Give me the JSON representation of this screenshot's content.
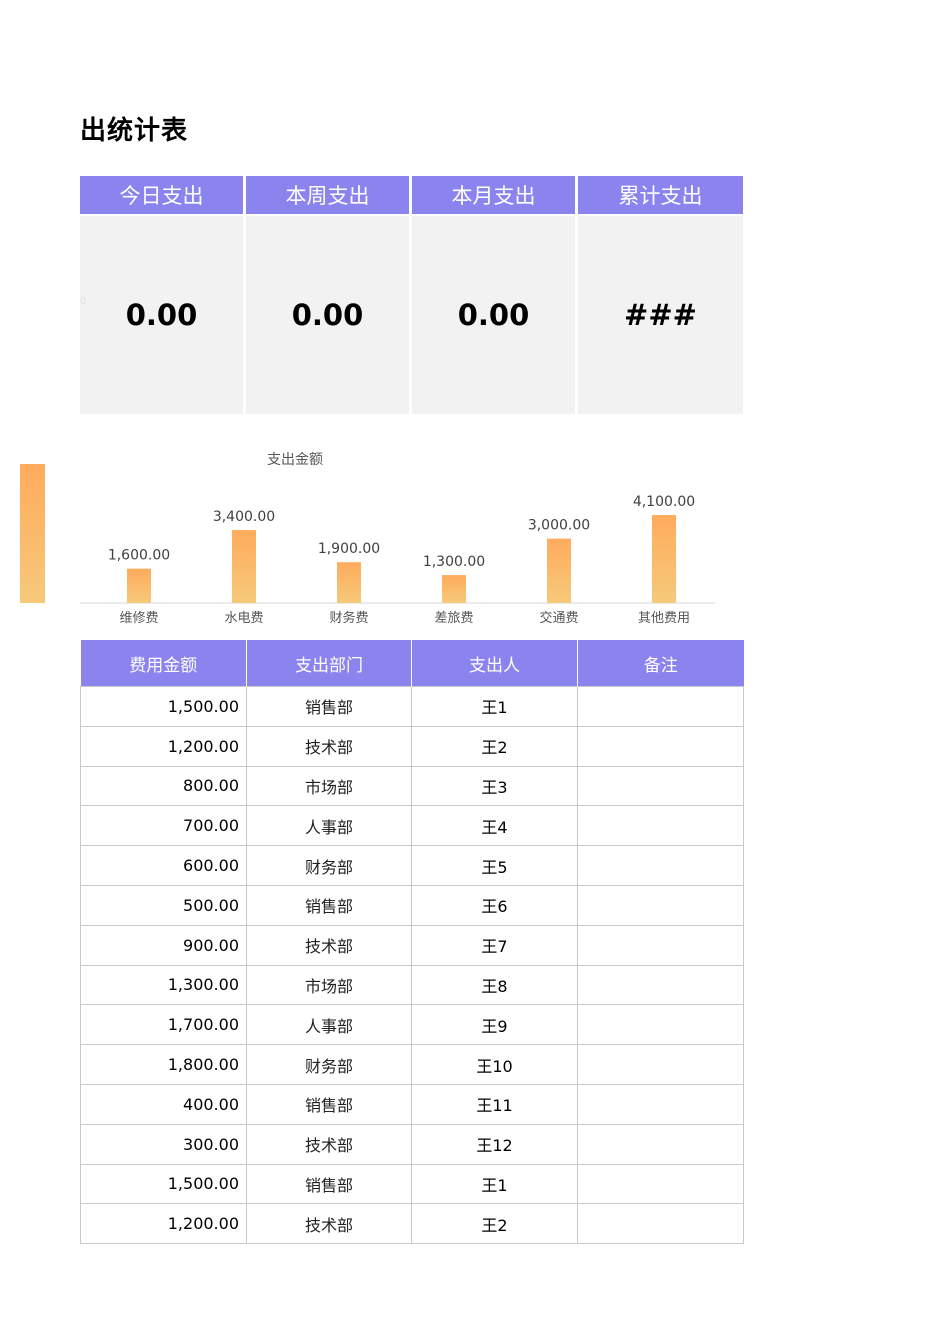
{
  "title": "出统计表",
  "faint_mark": "0",
  "summary": [
    {
      "label": "今日支出",
      "value": "0.00"
    },
    {
      "label": "本周支出",
      "value": "0.00"
    },
    {
      "label": "本月支出",
      "value": "0.00"
    },
    {
      "label": "累计支出",
      "value": "###"
    }
  ],
  "colors": {
    "header_bg": "#8b84ee",
    "card_bg": "#f2f2f2",
    "bar_top": "#ffab5c",
    "bar_bottom": "#f6c97a"
  },
  "chart_data": {
    "type": "bar",
    "title": "支出金额",
    "categories": [
      "维修费",
      "水电费",
      "财务费",
      "差旅费",
      "交通费",
      "其他费用"
    ],
    "values": [
      1600,
      3400,
      1900,
      1300,
      3000,
      4100
    ],
    "data_labels": [
      "1,600.00",
      "3,400.00",
      "1,900.00",
      "1,300.00",
      "3,000.00",
      "4,100.00"
    ],
    "ylim": [
      0,
      4100
    ],
    "grid": false,
    "legend": "none"
  },
  "table": {
    "headers": [
      "费用金额",
      "支出部门",
      "支出人",
      "备注"
    ],
    "rows": [
      {
        "amount": "1,500.00",
        "dept": "销售部",
        "person": "王1",
        "note": ""
      },
      {
        "amount": "1,200.00",
        "dept": "技术部",
        "person": "王2",
        "note": ""
      },
      {
        "amount": "800.00",
        "dept": "市场部",
        "person": "王3",
        "note": ""
      },
      {
        "amount": "700.00",
        "dept": "人事部",
        "person": "王4",
        "note": ""
      },
      {
        "amount": "600.00",
        "dept": "财务部",
        "person": "王5",
        "note": ""
      },
      {
        "amount": "500.00",
        "dept": "销售部",
        "person": "王6",
        "note": ""
      },
      {
        "amount": "900.00",
        "dept": "技术部",
        "person": "王7",
        "note": ""
      },
      {
        "amount": "1,300.00",
        "dept": "市场部",
        "person": "王8",
        "note": ""
      },
      {
        "amount": "1,700.00",
        "dept": "人事部",
        "person": "王9",
        "note": ""
      },
      {
        "amount": "1,800.00",
        "dept": "财务部",
        "person": "王10",
        "note": ""
      },
      {
        "amount": "400.00",
        "dept": "销售部",
        "person": "王11",
        "note": ""
      },
      {
        "amount": "300.00",
        "dept": "技术部",
        "person": "王12",
        "note": ""
      },
      {
        "amount": "1,500.00",
        "dept": "销售部",
        "person": "王1",
        "note": ""
      },
      {
        "amount": "1,200.00",
        "dept": "技术部",
        "person": "王2",
        "note": ""
      }
    ]
  }
}
